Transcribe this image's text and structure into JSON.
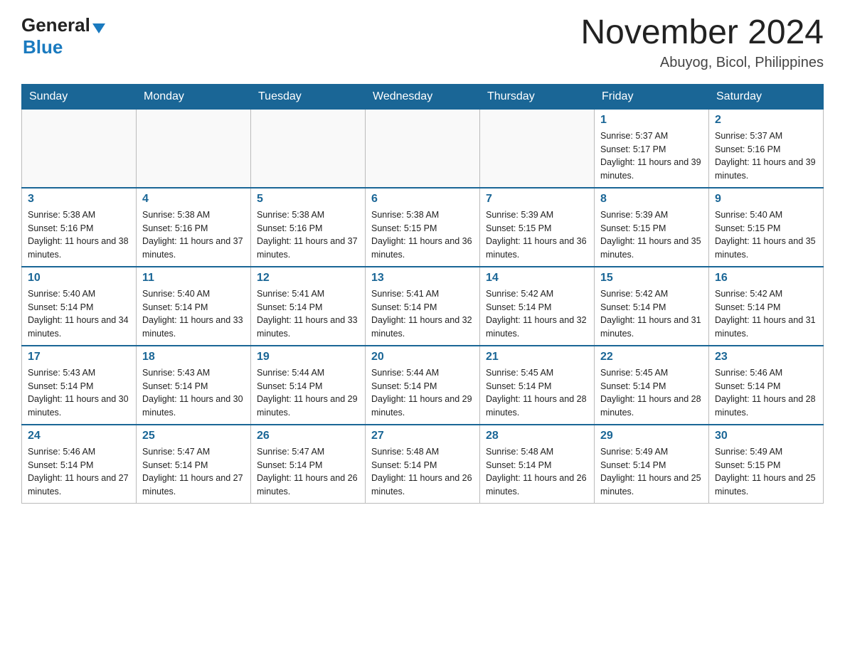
{
  "header": {
    "logo_general": "General",
    "logo_blue": "Blue",
    "month_title": "November 2024",
    "location": "Abuyog, Bicol, Philippines"
  },
  "days_of_week": [
    "Sunday",
    "Monday",
    "Tuesday",
    "Wednesday",
    "Thursday",
    "Friday",
    "Saturday"
  ],
  "weeks": [
    [
      {
        "day": "",
        "sunrise": "",
        "sunset": "",
        "daylight": ""
      },
      {
        "day": "",
        "sunrise": "",
        "sunset": "",
        "daylight": ""
      },
      {
        "day": "",
        "sunrise": "",
        "sunset": "",
        "daylight": ""
      },
      {
        "day": "",
        "sunrise": "",
        "sunset": "",
        "daylight": ""
      },
      {
        "day": "",
        "sunrise": "",
        "sunset": "",
        "daylight": ""
      },
      {
        "day": "1",
        "sunrise": "Sunrise: 5:37 AM",
        "sunset": "Sunset: 5:17 PM",
        "daylight": "Daylight: 11 hours and 39 minutes."
      },
      {
        "day": "2",
        "sunrise": "Sunrise: 5:37 AM",
        "sunset": "Sunset: 5:16 PM",
        "daylight": "Daylight: 11 hours and 39 minutes."
      }
    ],
    [
      {
        "day": "3",
        "sunrise": "Sunrise: 5:38 AM",
        "sunset": "Sunset: 5:16 PM",
        "daylight": "Daylight: 11 hours and 38 minutes."
      },
      {
        "day": "4",
        "sunrise": "Sunrise: 5:38 AM",
        "sunset": "Sunset: 5:16 PM",
        "daylight": "Daylight: 11 hours and 37 minutes."
      },
      {
        "day": "5",
        "sunrise": "Sunrise: 5:38 AM",
        "sunset": "Sunset: 5:16 PM",
        "daylight": "Daylight: 11 hours and 37 minutes."
      },
      {
        "day": "6",
        "sunrise": "Sunrise: 5:38 AM",
        "sunset": "Sunset: 5:15 PM",
        "daylight": "Daylight: 11 hours and 36 minutes."
      },
      {
        "day": "7",
        "sunrise": "Sunrise: 5:39 AM",
        "sunset": "Sunset: 5:15 PM",
        "daylight": "Daylight: 11 hours and 36 minutes."
      },
      {
        "day": "8",
        "sunrise": "Sunrise: 5:39 AM",
        "sunset": "Sunset: 5:15 PM",
        "daylight": "Daylight: 11 hours and 35 minutes."
      },
      {
        "day": "9",
        "sunrise": "Sunrise: 5:40 AM",
        "sunset": "Sunset: 5:15 PM",
        "daylight": "Daylight: 11 hours and 35 minutes."
      }
    ],
    [
      {
        "day": "10",
        "sunrise": "Sunrise: 5:40 AM",
        "sunset": "Sunset: 5:14 PM",
        "daylight": "Daylight: 11 hours and 34 minutes."
      },
      {
        "day": "11",
        "sunrise": "Sunrise: 5:40 AM",
        "sunset": "Sunset: 5:14 PM",
        "daylight": "Daylight: 11 hours and 33 minutes."
      },
      {
        "day": "12",
        "sunrise": "Sunrise: 5:41 AM",
        "sunset": "Sunset: 5:14 PM",
        "daylight": "Daylight: 11 hours and 33 minutes."
      },
      {
        "day": "13",
        "sunrise": "Sunrise: 5:41 AM",
        "sunset": "Sunset: 5:14 PM",
        "daylight": "Daylight: 11 hours and 32 minutes."
      },
      {
        "day": "14",
        "sunrise": "Sunrise: 5:42 AM",
        "sunset": "Sunset: 5:14 PM",
        "daylight": "Daylight: 11 hours and 32 minutes."
      },
      {
        "day": "15",
        "sunrise": "Sunrise: 5:42 AM",
        "sunset": "Sunset: 5:14 PM",
        "daylight": "Daylight: 11 hours and 31 minutes."
      },
      {
        "day": "16",
        "sunrise": "Sunrise: 5:42 AM",
        "sunset": "Sunset: 5:14 PM",
        "daylight": "Daylight: 11 hours and 31 minutes."
      }
    ],
    [
      {
        "day": "17",
        "sunrise": "Sunrise: 5:43 AM",
        "sunset": "Sunset: 5:14 PM",
        "daylight": "Daylight: 11 hours and 30 minutes."
      },
      {
        "day": "18",
        "sunrise": "Sunrise: 5:43 AM",
        "sunset": "Sunset: 5:14 PM",
        "daylight": "Daylight: 11 hours and 30 minutes."
      },
      {
        "day": "19",
        "sunrise": "Sunrise: 5:44 AM",
        "sunset": "Sunset: 5:14 PM",
        "daylight": "Daylight: 11 hours and 29 minutes."
      },
      {
        "day": "20",
        "sunrise": "Sunrise: 5:44 AM",
        "sunset": "Sunset: 5:14 PM",
        "daylight": "Daylight: 11 hours and 29 minutes."
      },
      {
        "day": "21",
        "sunrise": "Sunrise: 5:45 AM",
        "sunset": "Sunset: 5:14 PM",
        "daylight": "Daylight: 11 hours and 28 minutes."
      },
      {
        "day": "22",
        "sunrise": "Sunrise: 5:45 AM",
        "sunset": "Sunset: 5:14 PM",
        "daylight": "Daylight: 11 hours and 28 minutes."
      },
      {
        "day": "23",
        "sunrise": "Sunrise: 5:46 AM",
        "sunset": "Sunset: 5:14 PM",
        "daylight": "Daylight: 11 hours and 28 minutes."
      }
    ],
    [
      {
        "day": "24",
        "sunrise": "Sunrise: 5:46 AM",
        "sunset": "Sunset: 5:14 PM",
        "daylight": "Daylight: 11 hours and 27 minutes."
      },
      {
        "day": "25",
        "sunrise": "Sunrise: 5:47 AM",
        "sunset": "Sunset: 5:14 PM",
        "daylight": "Daylight: 11 hours and 27 minutes."
      },
      {
        "day": "26",
        "sunrise": "Sunrise: 5:47 AM",
        "sunset": "Sunset: 5:14 PM",
        "daylight": "Daylight: 11 hours and 26 minutes."
      },
      {
        "day": "27",
        "sunrise": "Sunrise: 5:48 AM",
        "sunset": "Sunset: 5:14 PM",
        "daylight": "Daylight: 11 hours and 26 minutes."
      },
      {
        "day": "28",
        "sunrise": "Sunrise: 5:48 AM",
        "sunset": "Sunset: 5:14 PM",
        "daylight": "Daylight: 11 hours and 26 minutes."
      },
      {
        "day": "29",
        "sunrise": "Sunrise: 5:49 AM",
        "sunset": "Sunset: 5:14 PM",
        "daylight": "Daylight: 11 hours and 25 minutes."
      },
      {
        "day": "30",
        "sunrise": "Sunrise: 5:49 AM",
        "sunset": "Sunset: 5:15 PM",
        "daylight": "Daylight: 11 hours and 25 minutes."
      }
    ]
  ]
}
